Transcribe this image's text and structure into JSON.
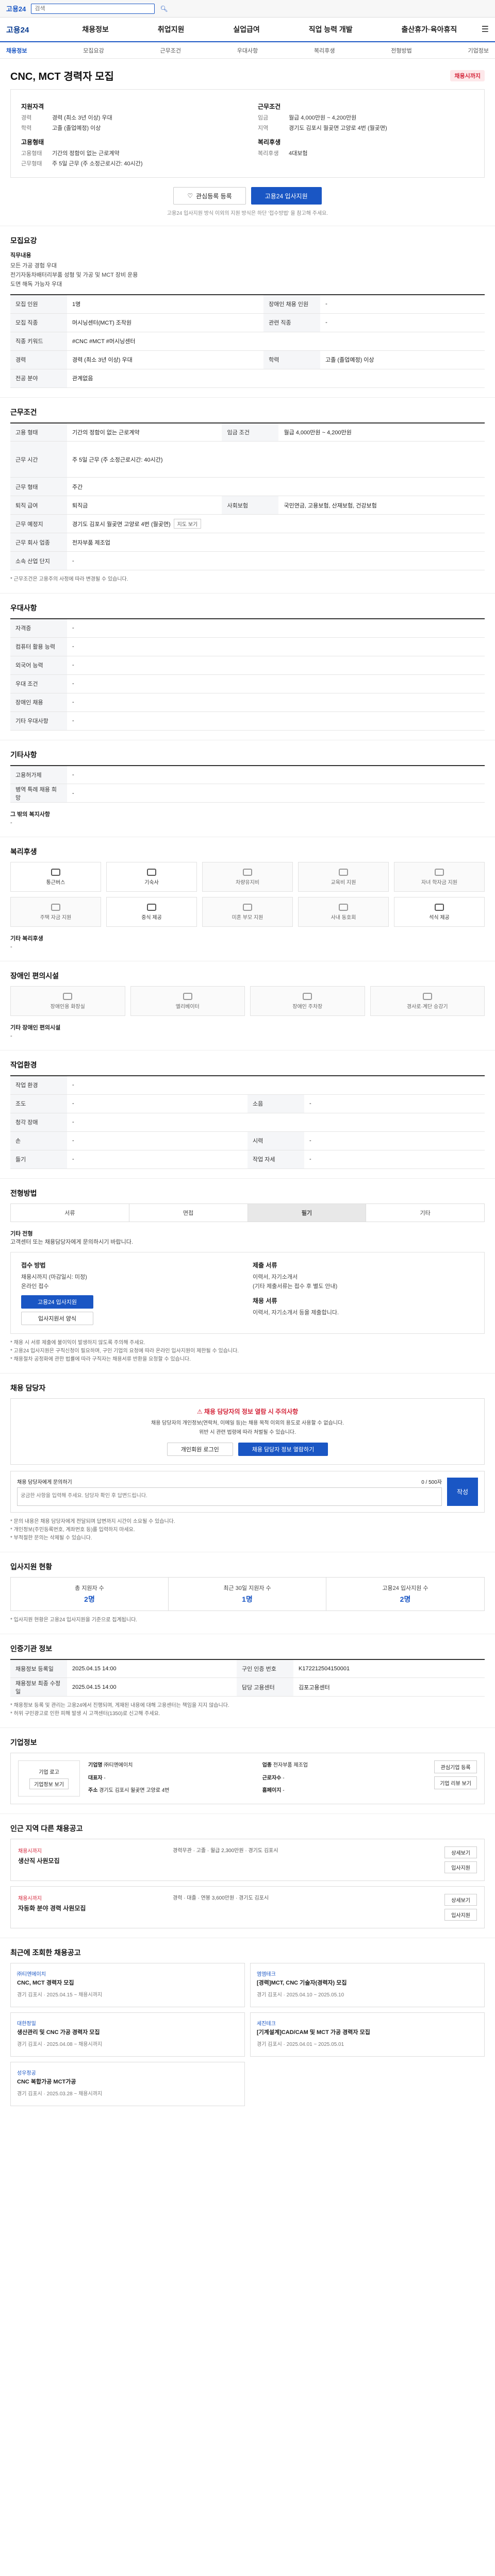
{
  "topbar": {
    "logo": "고용24",
    "search_placeholder": "검색"
  },
  "gnb": {
    "brand": "고용24",
    "menu": [
      "채용정보",
      "취업지원",
      "실업급여",
      "직업 능력 개발",
      "출산휴가·육아휴직"
    ]
  },
  "subnav": [
    "채용정보",
    "모집요강",
    "근무조건",
    "우대사항",
    "복리후생",
    "전형방법",
    "기업정보"
  ],
  "job": {
    "title": "CNC, MCT 경력자 모집",
    "badge": "채용시까지",
    "left_heading": "지원자격",
    "left": [
      {
        "k": "경력",
        "v": "경력 (최소 3년 이상) 우대"
      },
      {
        "k": "학력",
        "v": "고졸 (졸업예정) 이상"
      }
    ],
    "left_heading2": "고용형태",
    "left2": [
      {
        "k": "고용형태",
        "v": "기간의 정함이 없는 근로계약"
      },
      {
        "k": "근무형태",
        "v": "주 5일 근무 (주 소정근로시간: 40시간)"
      }
    ],
    "right_heading": "근무조건",
    "right": [
      {
        "k": "임금",
        "v": "월급 4,000만원 ~ 4,200만원"
      },
      {
        "k": "지역",
        "v": "경기도 김포시 월곶면 고양로 4번 (월곶면)"
      }
    ],
    "right_heading2": "복리후생",
    "right2": [
      {
        "k": "복리후생",
        "v": "4대보험"
      }
    ],
    "btn_interest": "관심등록 등록",
    "btn_apply": "고용24 입사지원",
    "apply_note": "고용24 입사지원 방식 이외의 지원 방식은 하단 '접수방법' 을 참고해 주세요."
  },
  "recruit": {
    "title": "모집요강",
    "desc_label": "직무내용",
    "desc": "모든 가공 경험 우대\n전기자동차배터리부품 성형 및 가공 및 MCT 장비 운용\n도면 해독 가능자 우대",
    "rows": [
      {
        "k": "모집 인원",
        "v": "1명",
        "k2": "장애인 채용 인원",
        "v2": "-"
      },
      {
        "k": "모집 직종",
        "v": "머시닝센터(MCT) 조작원",
        "k2": "관련 직종",
        "v2": "-"
      },
      {
        "k": "직종 키워드",
        "v": "#CNC #MCT #머시닝센터",
        "k2": "",
        "v2": ""
      },
      {
        "k": "경력",
        "v": "경력 (최소 3년 이상) 우대",
        "k2": "학력",
        "v2": "고졸 (졸업예정) 이상"
      },
      {
        "k": "전공 분야",
        "v": "관계없음",
        "k2": "",
        "v2": ""
      }
    ]
  },
  "conditions": {
    "title": "근무조건",
    "rows": [
      {
        "k": "고용 형태",
        "v": "기간의 정함이 없는 근로계약",
        "k2": "임금 조건",
        "v2": "월급 4,000만원 ~ 4,200만원"
      },
      {
        "k": "근무 시간",
        "v": "주 5일 근무 (주 소정근로시간: 40시간)",
        "k2": "",
        "v2": ""
      },
      {
        "k": "근무 형태",
        "v": "주간",
        "k2": "",
        "v2": ""
      },
      {
        "k": "퇴직 급여",
        "v": "퇴직금",
        "k2": "사회보험",
        "v2": "국민연금, 고용보험, 산재보험, 건강보험"
      },
      {
        "k": "근무 예정지",
        "v": "경기도 김포시 월곶면 고양로 4번 (월곶면)",
        "k2": "",
        "v2": ""
      },
      {
        "k": "근무 회사 업종",
        "v": "전자부품 제조업",
        "k2": "",
        "v2": ""
      },
      {
        "k": "소속 산업 단지",
        "v": "-",
        "k2": "",
        "v2": ""
      }
    ],
    "map_chip": "지도 보기",
    "footnote": "* 근무조건은 고용주의 사정에 따라 변경될 수 있습니다."
  },
  "preferred": {
    "title": "우대사항",
    "rows": [
      {
        "k": "자격증",
        "v": "-"
      },
      {
        "k": "컴퓨터 활용 능력",
        "v": "-"
      },
      {
        "k": "외국어 능력",
        "v": "-"
      },
      {
        "k": "우대 조건",
        "v": "-"
      },
      {
        "k": "장애인 채용",
        "v": "-"
      },
      {
        "k": "기타 우대사항",
        "v": "-"
      }
    ]
  },
  "etc": {
    "title": "기타사항",
    "rows": [
      {
        "k": "고용허가제",
        "v": "-"
      },
      {
        "k": "병역 특례 채용 희망",
        "v": "-"
      }
    ],
    "other_label": "그 밖의 복지사항",
    "other_value": "-"
  },
  "welfare": {
    "title": "복리후생",
    "items": [
      {
        "label": "통근버스",
        "on": true
      },
      {
        "label": "기숙사",
        "on": true
      },
      {
        "label": "차량유지비",
        "on": false
      },
      {
        "label": "교육비 지원",
        "on": false
      },
      {
        "label": "자녀 학자금 지원",
        "on": false
      },
      {
        "label": "주택 자금 지원",
        "on": false
      },
      {
        "label": "중식 제공",
        "on": true
      },
      {
        "label": "미혼 부모 지원",
        "on": false
      },
      {
        "label": "사내 동호회",
        "on": false
      },
      {
        "label": "석식 제공",
        "on": true
      }
    ],
    "other_label": "기타 복리후생",
    "other_value": "-"
  },
  "disabled": {
    "title": "장애인 편의시설",
    "items": [
      "장애인용 화장실",
      "엘리베이터",
      "장애인 주차장",
      "경사로·계단 승강기"
    ],
    "other_label": "기타 장애인 편의시설",
    "other_value": "-"
  },
  "workenv": {
    "title": "작업환경",
    "rows": [
      {
        "k": "작업 환경",
        "v": "-",
        "k2": "",
        "v2": ""
      },
      {
        "k": "조도",
        "v": "-",
        "k2": "소음",
        "v2": "-"
      },
      {
        "k": "청각 장애",
        "v": "-",
        "k2": "",
        "v2": ""
      },
      {
        "k": "손",
        "v": "-",
        "k2": "시력",
        "v2": "-"
      },
      {
        "k": "들기",
        "v": "-",
        "k2": "작업 자세",
        "v2": "-"
      }
    ]
  },
  "selection": {
    "title": "전형방법",
    "tabs": [
      "서류",
      "면접",
      "필기",
      "기타"
    ],
    "active_tab": 2,
    "other_label": "기타 전형",
    "other_value": "고객센터 또는 채용담당자에게 문의하시기 바랍니다.",
    "method_title": "접수 방법",
    "deadline_label": "채용시까지 (마감일시: 미정)",
    "online": "온라인 접수",
    "btn_apply": "고용24 입사지원",
    "btn_form": "입사지원서 양식",
    "docs_title": "제출 서류",
    "docs": "이력서, 자기소개서",
    "docs_note": "(기타 제출서류는 접수 후 별도 안내)",
    "result_title": "채용 서류",
    "result": "이력서, 자기소개서 등을 제출합니다.",
    "notes": "* 채용 시 서류 제출에 불이익이 발생하지 않도록 주의해 주세요.\n* 고용24 입사지원은 구직신청이 필요하며, 구인 기업의 요청에 따라 온라인 입사지원이 제한될 수 있습니다.\n* 채용절차 공정화에 관한 법률에 따라 구직자는 채용서류 반환을 요청할 수 있습니다."
  },
  "manager": {
    "title": "채용 담당자",
    "warn_title": "채용 담당자의 정보 열람 시 주의사항",
    "warn_text": "채용 담당자의 개인정보(연락처, 이메일 등)는 채용 목적 이외의 용도로 사용할 수 없습니다.\n위반 시 관련 법령에 따라 처벌될 수 있습니다.",
    "btn_login": "개인회원 로그인",
    "btn_view": "채용 담당자 정보 열람하기",
    "inquiry_label": "채용 담당자에게 문의하기",
    "inquiry_placeholder": "궁금한 사항을 입력해 주세요. 담당자 확인 후 답변드립니다.",
    "count": "0 / 500자",
    "send": "작성",
    "notes": "* 문의 내용은 채용 담당자에게 전달되며 답변까지 시간이 소요될 수 있습니다.\n* 개인정보(주민등록번호, 계좌번호 등)를 입력하지 마세요.\n* 부적절한 문의는 삭제될 수 있습니다."
  },
  "stats": {
    "title": "입사지원 현황",
    "items": [
      {
        "label": "총 지원자 수",
        "value": "2명"
      },
      {
        "label": "최근 30일 지원자 수",
        "value": "1명"
      },
      {
        "label": "고용24 입사지원 수",
        "value": "2명"
      }
    ],
    "note": "* 입사지원 현황은 고용24 입사지원을 기준으로 집계됩니다."
  },
  "agency": {
    "title": "인증기관 정보",
    "rows": [
      {
        "k": "채용정보 등록일",
        "v": "2025.04.15 14:00",
        "k2": "구인 인증 번호",
        "v2": "K172212504150001"
      },
      {
        "k": "채용정보 최종 수정일",
        "v": "2025.04.15 14:00",
        "k2": "담당 고용센터",
        "v2": "김포고용센터"
      }
    ],
    "notes": "* 채용정보 등록 및 관리는 고용24에서 진행되며, 게재된 내용에 대해 고용센터는 책임을 지지 않습니다.\n* 허위 구인광고로 인한 피해 발생 시 고객센터(1350)로 신고해 주세요."
  },
  "company": {
    "title": "기업정보",
    "logo_label": "기업 로고",
    "logo_btn": "기업정보 보기",
    "fields": [
      {
        "k": "기업명",
        "v": "㈜티엔에이치"
      },
      {
        "k": "업종",
        "v": "전자부품 제조업"
      },
      {
        "k": "대표자",
        "v": "-"
      },
      {
        "k": "근로자수",
        "v": "-"
      },
      {
        "k": "주소",
        "v": "경기도 김포시 월곶면 고양로 4번"
      },
      {
        "k": "홈페이지",
        "v": "-"
      }
    ],
    "side": [
      "관심기업 등록",
      "기업 리뷰 보기"
    ]
  },
  "nearby": {
    "title": "인근 지역 다른 채용공고",
    "jobs": [
      {
        "co": "채용시까지",
        "title": "생산직 사원모집",
        "meta": "경력무관 · 고졸 · 월급 2,300만원 · 경기도 김포시",
        "btns": [
          "상세보기",
          "입사지원"
        ]
      },
      {
        "co": "채용시까지",
        "title": "자동화 분야 경력 사원모집",
        "meta": "경력 · 대졸 · 연봉 3,600만원 · 경기도 김포시",
        "btns": [
          "상세보기",
          "입사지원"
        ]
      }
    ]
  },
  "recent": {
    "title": "최근에 조회한 채용공고",
    "items": [
      {
        "co": "㈜티엔에이치",
        "title": "CNC, MCT 경력자 모집",
        "meta": "경기 김포시 · 2025.04.15 ~ 채용시까지"
      },
      {
        "co": "엠엠테크",
        "title": "[경력]MCT, CNC 기술자(경력자) 모집",
        "meta": "경기 김포시 · 2025.04.10 ~ 2025.05.10"
      },
      {
        "co": "대한정밀",
        "title": "생산관리 및 CNC 가공 경력자 모집",
        "meta": "경기 김포시 · 2025.04.08 ~ 채용시까지"
      },
      {
        "co": "세진테크",
        "title": "[기계설계]CAD/CAM 및 MCT 가공 경력자 모집",
        "meta": "경기 김포시 · 2025.04.01 ~ 2025.05.01"
      },
      {
        "co": "성우정공",
        "title": "CNC 복합가공 MCT가공",
        "meta": "경기 김포시 · 2025.03.28 ~ 채용시까지"
      }
    ]
  }
}
